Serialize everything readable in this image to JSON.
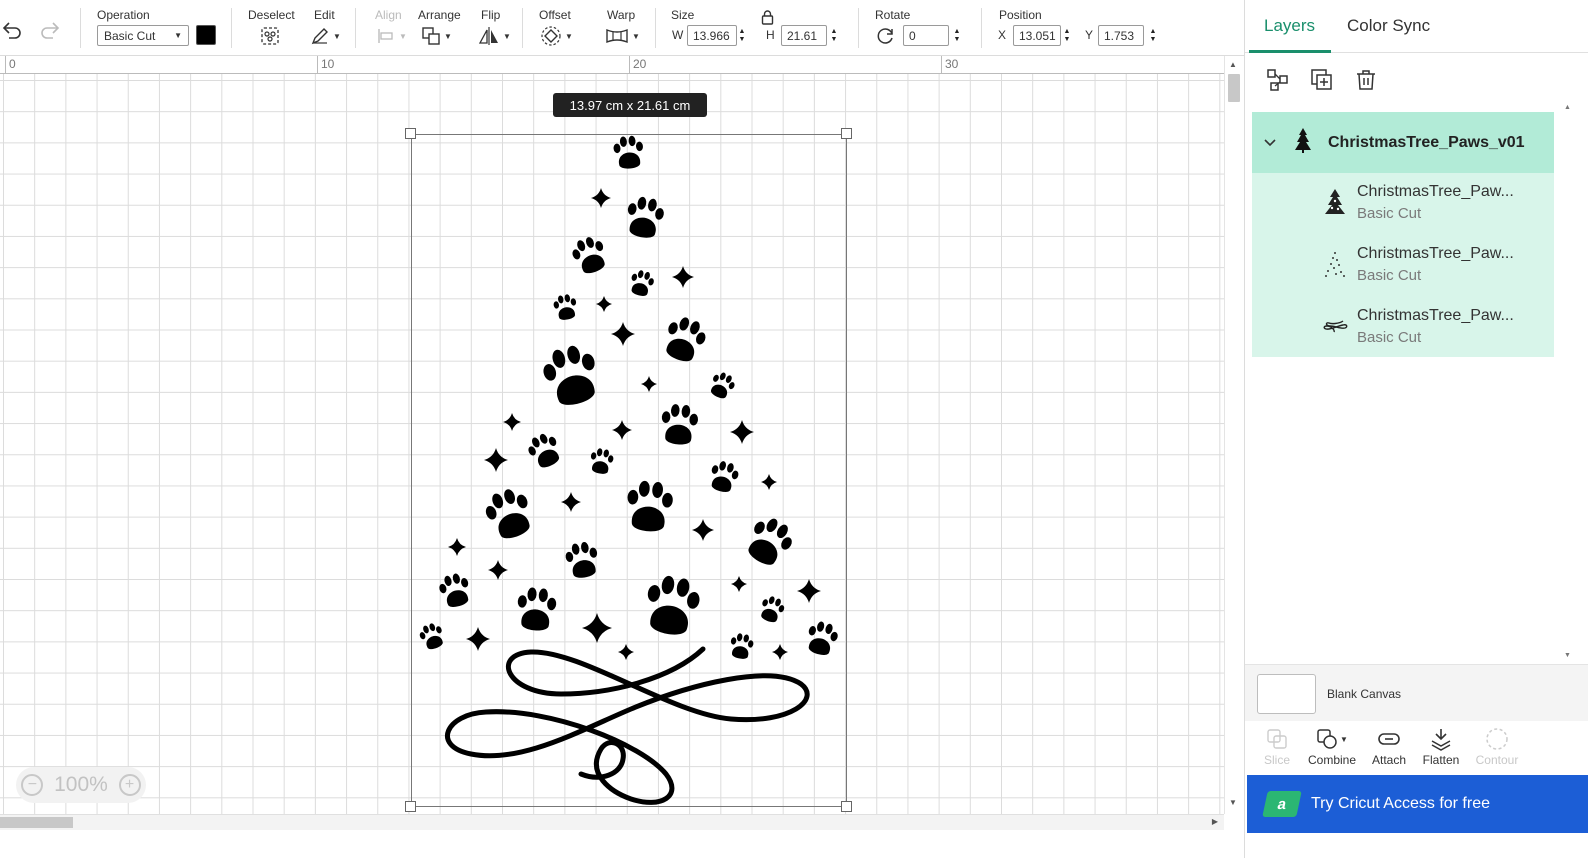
{
  "toolbar": {
    "operation": {
      "label": "Operation",
      "value": "Basic Cut",
      "color": "#000000"
    },
    "deselect_label": "Deselect",
    "edit_label": "Edit",
    "align_label": "Align",
    "arrange_label": "Arrange",
    "flip_label": "Flip",
    "offset_label": "Offset",
    "warp_label": "Warp",
    "size": {
      "label": "Size",
      "w_letter": "W",
      "w_value": "13.966",
      "h_letter": "H",
      "h_value": "21.61"
    },
    "rotate": {
      "label": "Rotate",
      "value": "0"
    },
    "position": {
      "label": "Position",
      "x_letter": "X",
      "x_value": "13.051",
      "y_letter": "Y",
      "y_value": "1.753"
    }
  },
  "ruler": {
    "labels": [
      "0",
      "10",
      "20",
      "30"
    ]
  },
  "canvas": {
    "size_tooltip": "13.97  cm x 21.61  cm",
    "zoom": {
      "value": "100%",
      "minus": "−",
      "plus": "+"
    }
  },
  "panel": {
    "tabs": [
      {
        "label": "Layers"
      },
      {
        "label": "Color Sync"
      }
    ],
    "group": {
      "name": "ChristmasTree_Paws_v01",
      "icon": "tree-icon"
    },
    "layers": [
      {
        "name": "ChristmasTree_Paw...",
        "operation": "Basic Cut",
        "icon": "tree-layer-icon"
      },
      {
        "name": "ChristmasTree_Paw...",
        "operation": "Basic Cut",
        "icon": "dots-layer-icon"
      },
      {
        "name": "ChristmasTree_Paw...",
        "operation": "Basic Cut",
        "icon": "swirl-layer-icon"
      }
    ],
    "blank_canvas_label": "Blank Canvas",
    "tools": {
      "slice": "Slice",
      "combine": "Combine",
      "attach": "Attach",
      "flatten": "Flatten",
      "contour": "Contour"
    },
    "access": {
      "badge": "a",
      "label": "Try Cricut Access for free",
      "color": "#1c5ed6"
    }
  },
  "colors": {
    "accent": "#1a8f6c",
    "layer_group_bg": "#b2ebd7",
    "layer_child_bg": "#d8f5ea"
  }
}
